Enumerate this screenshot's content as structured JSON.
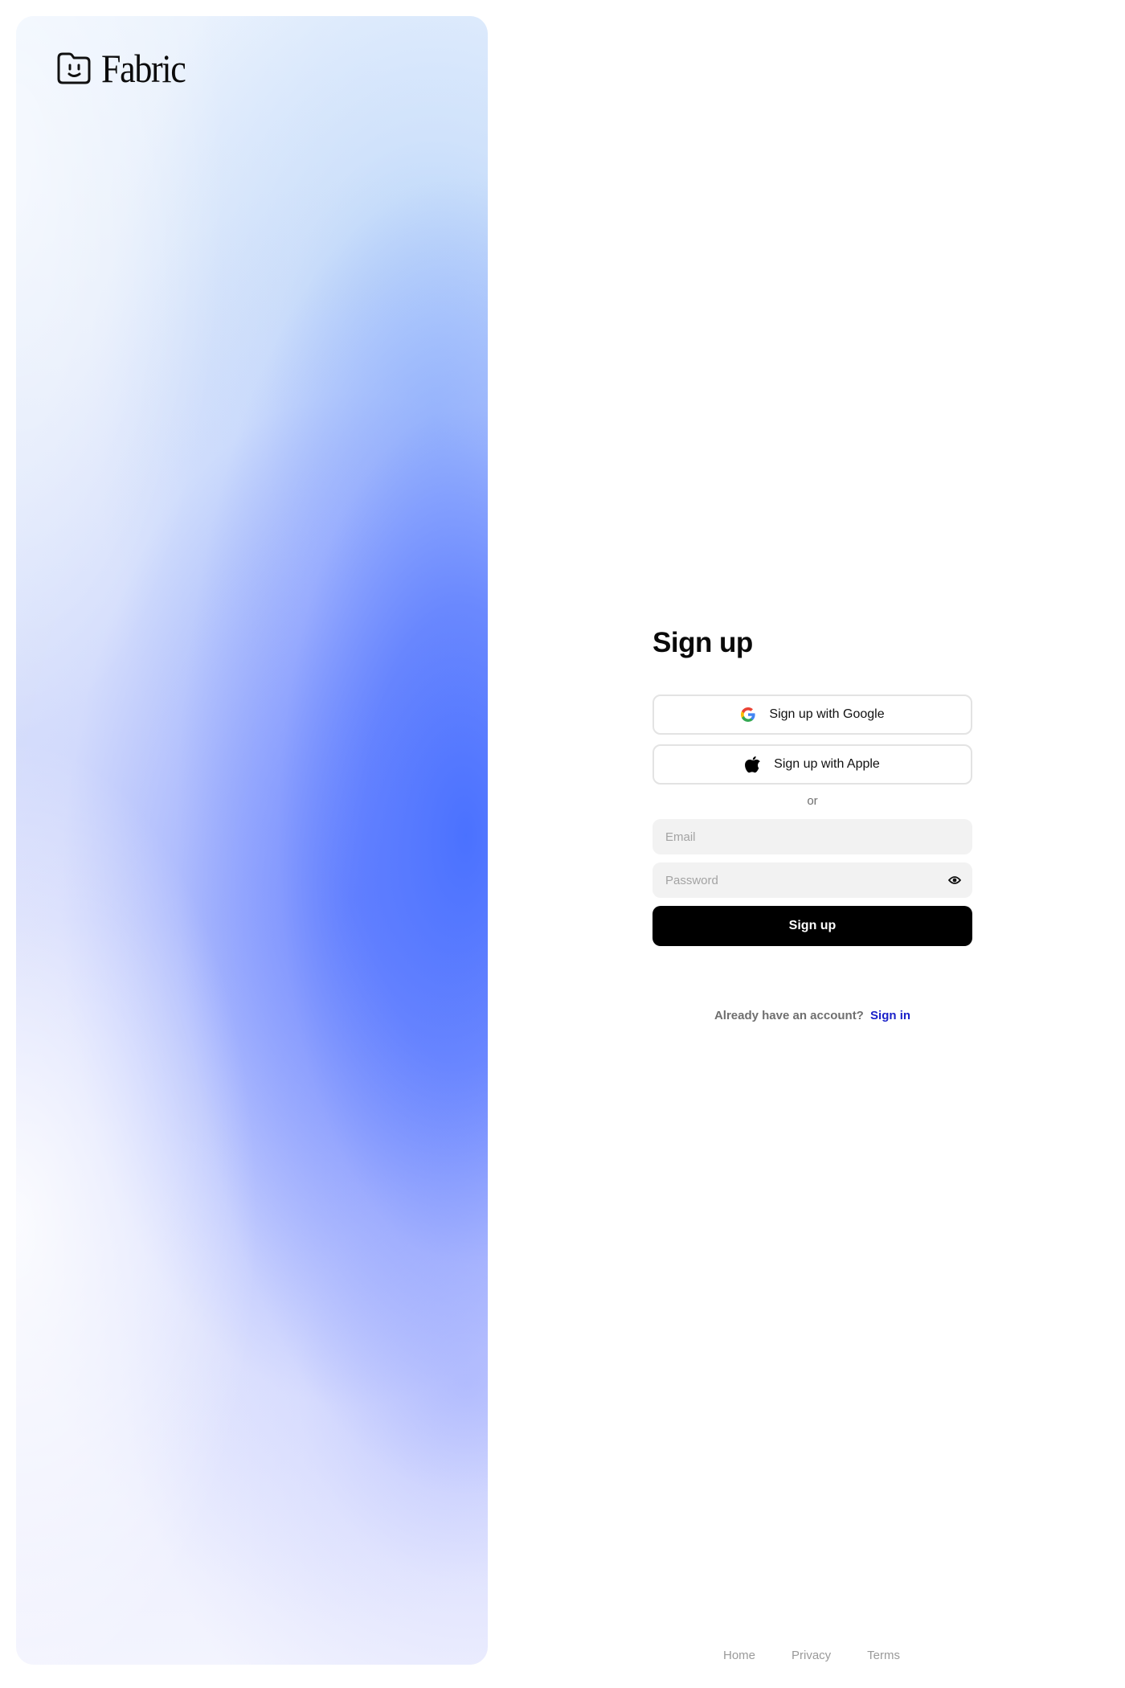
{
  "brand": {
    "name": "Fabric",
    "icon": "smiling-folder-icon"
  },
  "hero": {
    "accent_color": "#4f74ff"
  },
  "form": {
    "title": "Sign up",
    "google_button": {
      "label": "Sign up with Google",
      "icon": "google-icon"
    },
    "apple_button": {
      "label": "Sign up with Apple",
      "icon": "apple-icon"
    },
    "divider": "or",
    "email": {
      "placeholder": "Email",
      "value": ""
    },
    "password": {
      "placeholder": "Password",
      "value": "",
      "toggle_icon": "eye-icon"
    },
    "submit_label": "Sign up",
    "account_prompt": "Already have an account?",
    "signin_link": "Sign in",
    "link_color": "#1a21c9",
    "primary_color": "#000000"
  },
  "footer": {
    "links": [
      "Home",
      "Privacy",
      "Terms"
    ]
  }
}
